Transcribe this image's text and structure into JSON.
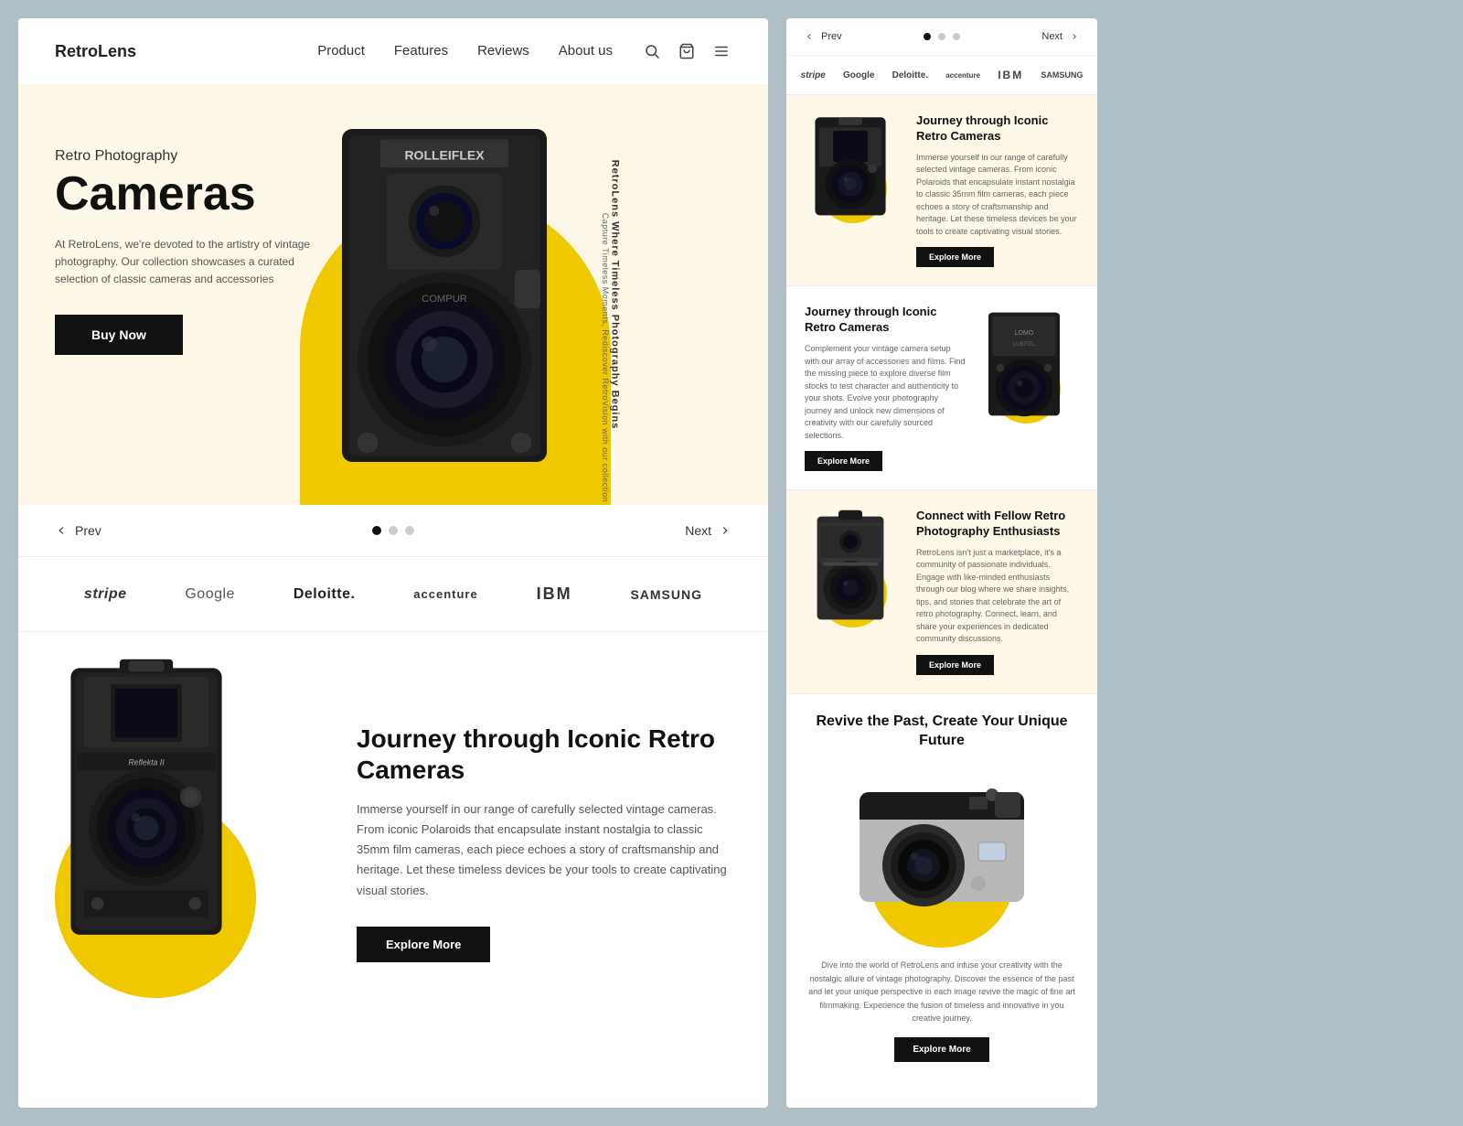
{
  "brand": "RetroLens",
  "nav": {
    "links": [
      "Product",
      "Features",
      "Reviews",
      "About us"
    ]
  },
  "hero": {
    "subtitle": "Retro Photography",
    "title": "Cameras",
    "description": "At RetroLens, we're devoted to the artistry of vintage photography. Our collection showcases a curated selection of classic cameras and accessories",
    "buy_button": "Buy Now",
    "vertical_text": "RetroLens  Where Timeless Photography Begins",
    "vertical_small": "Capture Timeless Moments, Rediscover RetroVision with our collection"
  },
  "pagination": {
    "prev": "Prev",
    "next": "Next"
  },
  "partners": [
    "stripe",
    "Google",
    "Deloitte.",
    "accenture",
    "IBM",
    "SAMSUNG"
  ],
  "bottom_section": {
    "title": "Journey through Iconic Retro Cameras",
    "description": "Immerse yourself in our range of carefully selected vintage cameras. From iconic Polaroids that encapsulate instant nostalgia to classic 35mm film cameras, each piece echoes a story of craftsmanship and heritage. Let these timeless devices be your tools to create captivating visual stories.",
    "explore_button": "Explore More"
  },
  "right_panel": {
    "cards": [
      {
        "title": "Journey through Iconic Retro Cameras",
        "description": "Immerse yourself in our range of carefully selected vintage cameras. From iconic Polaroids that encapsulate instant nostalgia to classic 35mm film cameras, each piece echoes a story of craftsmanship and heritage. Let these timeless devices be your tools to create captivating visual stories.",
        "button": "Explore More"
      },
      {
        "title": "Journey through Iconic Retro Cameras",
        "description": "Complement your vintage camera setup with our array of accessories and films. Find the missing piece to explore diverse film stocks to test character and authenticity to your shots. Evolve your photography journey and unlock new dimensions of creativity with our carefully sourced selections.",
        "button": "Explore More"
      },
      {
        "title": "Connect with Fellow Retro Photography Enthusiasts",
        "description": "RetroLens isn't just a marketplace, it's a community of passionate individuals. Engage with like-minded enthusiasts through our blog where we share insights, tips, and stories that celebrate the art of retro photography. Connect, learn, and share your experiences in dedicated community discussions.",
        "button": "Explore More"
      }
    ],
    "bottom": {
      "title": "Revive the Past, Create Your Unique Future",
      "description": "Dive into the world of RetroLens and infuse your creativity with the nostalgic allure of vintage photography. Discover the essence of the past and let your unique perspective in each image revive the magic of fine art filmmaking. Experience the fusion of timeless and innovative in you creative journey.",
      "button": "Explore More"
    }
  }
}
